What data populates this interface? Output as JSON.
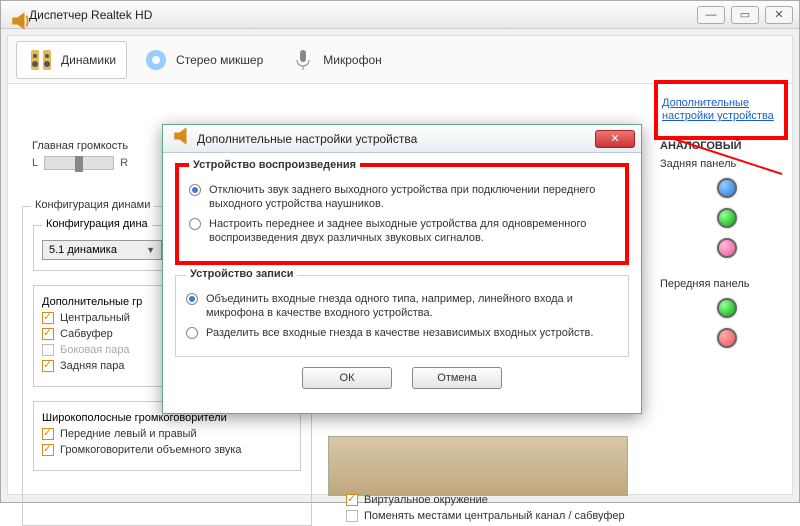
{
  "window": {
    "title": "Диспетчер Realtek HD",
    "buttons": {
      "min": "—",
      "max": "▭",
      "close": "✕"
    }
  },
  "tabs": {
    "speakers": "Динамики",
    "stereo_mix": "Стерео микшер",
    "microphone": "Микрофон"
  },
  "advanced_link": "Дополнительные настройки устройства",
  "volume": {
    "label": "Главная громкость",
    "left": "L",
    "right": "R"
  },
  "config_section": {
    "title": "Конфигурация динами",
    "inner_title": "Конфигурация дина",
    "dropdown_value": "5.1 динамика",
    "optional_title": "Дополнительные гр",
    "items": {
      "center": "Центральный",
      "subwoofer": "Сабвуфер",
      "side_pair": "Боковая пара",
      "rear_pair": "Задняя пара"
    },
    "fullrange_title": "Широкополосные громкоговорители",
    "fullrange_items": {
      "front": "Передние левый и правый",
      "surround": "Громкоговорители объемного звука"
    }
  },
  "extras": {
    "virtual_surround": "Виртуальное окружение",
    "swap_center_sub": "Поменять местами центральный канал / сабвуфер"
  },
  "right": {
    "analog": "АНАЛОГОВЫЙ",
    "rear_panel": "Задняя панель",
    "front_panel": "Передняя панель"
  },
  "dialog": {
    "title": "Дополнительные настройки устройства",
    "playback": {
      "legend": "Устройство воспроизведения",
      "opt1": "Отключить звук заднего выходного устройства при подключении переднего выходного устройства наушников.",
      "opt2": "Настроить переднее и заднее выходные устройства для одновременного воспроизведения двух различных звуковых сигналов."
    },
    "recording": {
      "legend": "Устройство записи",
      "opt1": "Объединить входные гнезда одного типа, например, линейного входа и микрофона в качестве входного устройства.",
      "opt2": "Разделить все входные гнезда в качестве независимых входных устройств."
    },
    "buttons": {
      "ok": "ОК",
      "cancel": "Отмена"
    }
  }
}
